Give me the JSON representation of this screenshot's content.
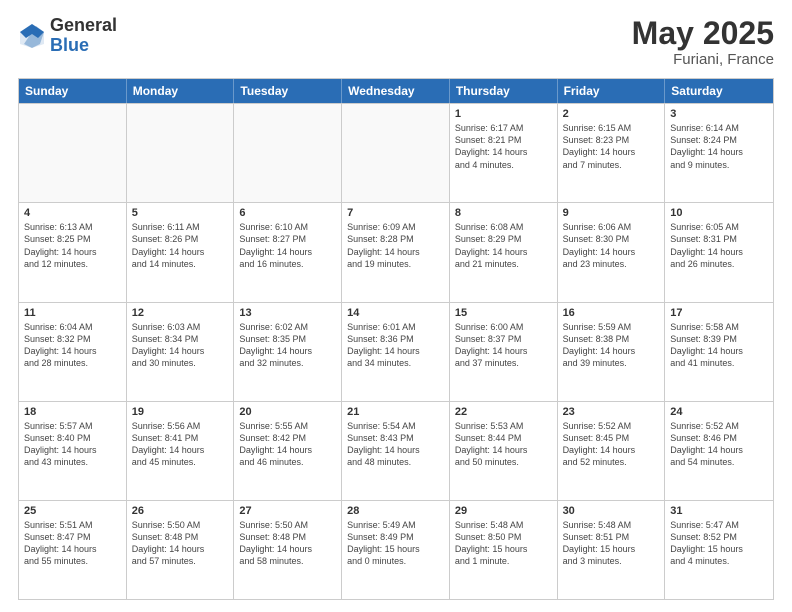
{
  "header": {
    "logo_general": "General",
    "logo_blue": "Blue",
    "month_year": "May 2025",
    "location": "Furiani, France"
  },
  "days_of_week": [
    "Sunday",
    "Monday",
    "Tuesday",
    "Wednesday",
    "Thursday",
    "Friday",
    "Saturday"
  ],
  "rows": [
    [
      {
        "day": "",
        "text": ""
      },
      {
        "day": "",
        "text": ""
      },
      {
        "day": "",
        "text": ""
      },
      {
        "day": "",
        "text": ""
      },
      {
        "day": "1",
        "text": "Sunrise: 6:17 AM\nSunset: 8:21 PM\nDaylight: 14 hours\nand 4 minutes."
      },
      {
        "day": "2",
        "text": "Sunrise: 6:15 AM\nSunset: 8:23 PM\nDaylight: 14 hours\nand 7 minutes."
      },
      {
        "day": "3",
        "text": "Sunrise: 6:14 AM\nSunset: 8:24 PM\nDaylight: 14 hours\nand 9 minutes."
      }
    ],
    [
      {
        "day": "4",
        "text": "Sunrise: 6:13 AM\nSunset: 8:25 PM\nDaylight: 14 hours\nand 12 minutes."
      },
      {
        "day": "5",
        "text": "Sunrise: 6:11 AM\nSunset: 8:26 PM\nDaylight: 14 hours\nand 14 minutes."
      },
      {
        "day": "6",
        "text": "Sunrise: 6:10 AM\nSunset: 8:27 PM\nDaylight: 14 hours\nand 16 minutes."
      },
      {
        "day": "7",
        "text": "Sunrise: 6:09 AM\nSunset: 8:28 PM\nDaylight: 14 hours\nand 19 minutes."
      },
      {
        "day": "8",
        "text": "Sunrise: 6:08 AM\nSunset: 8:29 PM\nDaylight: 14 hours\nand 21 minutes."
      },
      {
        "day": "9",
        "text": "Sunrise: 6:06 AM\nSunset: 8:30 PM\nDaylight: 14 hours\nand 23 minutes."
      },
      {
        "day": "10",
        "text": "Sunrise: 6:05 AM\nSunset: 8:31 PM\nDaylight: 14 hours\nand 26 minutes."
      }
    ],
    [
      {
        "day": "11",
        "text": "Sunrise: 6:04 AM\nSunset: 8:32 PM\nDaylight: 14 hours\nand 28 minutes."
      },
      {
        "day": "12",
        "text": "Sunrise: 6:03 AM\nSunset: 8:34 PM\nDaylight: 14 hours\nand 30 minutes."
      },
      {
        "day": "13",
        "text": "Sunrise: 6:02 AM\nSunset: 8:35 PM\nDaylight: 14 hours\nand 32 minutes."
      },
      {
        "day": "14",
        "text": "Sunrise: 6:01 AM\nSunset: 8:36 PM\nDaylight: 14 hours\nand 34 minutes."
      },
      {
        "day": "15",
        "text": "Sunrise: 6:00 AM\nSunset: 8:37 PM\nDaylight: 14 hours\nand 37 minutes."
      },
      {
        "day": "16",
        "text": "Sunrise: 5:59 AM\nSunset: 8:38 PM\nDaylight: 14 hours\nand 39 minutes."
      },
      {
        "day": "17",
        "text": "Sunrise: 5:58 AM\nSunset: 8:39 PM\nDaylight: 14 hours\nand 41 minutes."
      }
    ],
    [
      {
        "day": "18",
        "text": "Sunrise: 5:57 AM\nSunset: 8:40 PM\nDaylight: 14 hours\nand 43 minutes."
      },
      {
        "day": "19",
        "text": "Sunrise: 5:56 AM\nSunset: 8:41 PM\nDaylight: 14 hours\nand 45 minutes."
      },
      {
        "day": "20",
        "text": "Sunrise: 5:55 AM\nSunset: 8:42 PM\nDaylight: 14 hours\nand 46 minutes."
      },
      {
        "day": "21",
        "text": "Sunrise: 5:54 AM\nSunset: 8:43 PM\nDaylight: 14 hours\nand 48 minutes."
      },
      {
        "day": "22",
        "text": "Sunrise: 5:53 AM\nSunset: 8:44 PM\nDaylight: 14 hours\nand 50 minutes."
      },
      {
        "day": "23",
        "text": "Sunrise: 5:52 AM\nSunset: 8:45 PM\nDaylight: 14 hours\nand 52 minutes."
      },
      {
        "day": "24",
        "text": "Sunrise: 5:52 AM\nSunset: 8:46 PM\nDaylight: 14 hours\nand 54 minutes."
      }
    ],
    [
      {
        "day": "25",
        "text": "Sunrise: 5:51 AM\nSunset: 8:47 PM\nDaylight: 14 hours\nand 55 minutes."
      },
      {
        "day": "26",
        "text": "Sunrise: 5:50 AM\nSunset: 8:48 PM\nDaylight: 14 hours\nand 57 minutes."
      },
      {
        "day": "27",
        "text": "Sunrise: 5:50 AM\nSunset: 8:48 PM\nDaylight: 14 hours\nand 58 minutes."
      },
      {
        "day": "28",
        "text": "Sunrise: 5:49 AM\nSunset: 8:49 PM\nDaylight: 15 hours\nand 0 minutes."
      },
      {
        "day": "29",
        "text": "Sunrise: 5:48 AM\nSunset: 8:50 PM\nDaylight: 15 hours\nand 1 minute."
      },
      {
        "day": "30",
        "text": "Sunrise: 5:48 AM\nSunset: 8:51 PM\nDaylight: 15 hours\nand 3 minutes."
      },
      {
        "day": "31",
        "text": "Sunrise: 5:47 AM\nSunset: 8:52 PM\nDaylight: 15 hours\nand 4 minutes."
      }
    ]
  ]
}
